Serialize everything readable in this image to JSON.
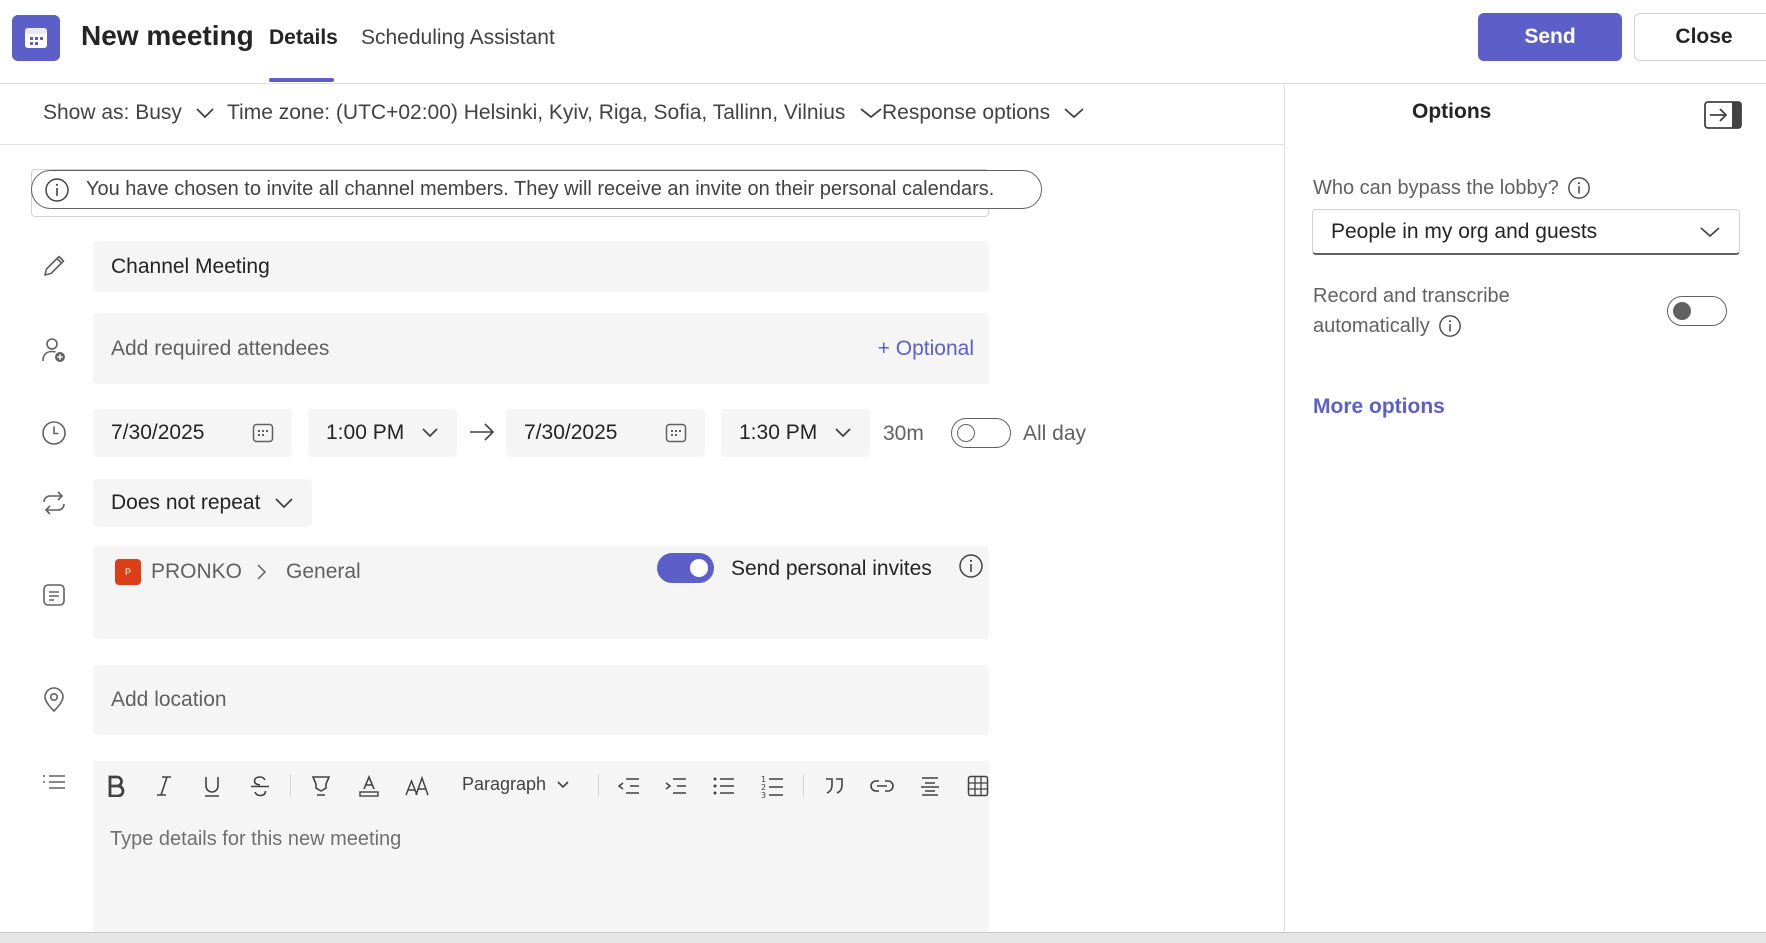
{
  "header": {
    "title": "New meeting",
    "tabs": [
      {
        "label": "Details",
        "active": true
      },
      {
        "label": "Scheduling Assistant",
        "active": false
      }
    ],
    "send_label": "Send",
    "close_label": "Close"
  },
  "subbar": {
    "show_as": "Show as: Busy",
    "time_zone": "Time zone: (UTC+02:00) Helsinki, Kyiv, Riga, Sofia, Tallinn, Vilnius",
    "response_options": "Response options"
  },
  "banner": {
    "text": "You have chosen to invite all channel members. They will receive an invite on their personal calendars."
  },
  "form": {
    "title_value": "Channel Meeting",
    "attendees_placeholder": "Add required attendees",
    "optional_link": "+ Optional",
    "start_date": "7/30/2025",
    "start_time": "1:00 PM",
    "end_date": "7/30/2025",
    "end_time": "1:30 PM",
    "duration": "30m",
    "all_day_label": "All day",
    "all_day_on": false,
    "repeat": "Does not repeat",
    "channel": {
      "team_badge": "P",
      "team": "PRONKO",
      "channel": "General",
      "send_invites_label": "Send personal invites",
      "send_invites_on": true
    },
    "location_placeholder": "Add location",
    "editor": {
      "paragraph_label": "Paragraph",
      "placeholder": "Type details for this new meeting"
    }
  },
  "options_panel": {
    "title": "Options",
    "lobby_label": "Who can bypass the lobby?",
    "lobby_value": "People in my org and guests",
    "record_label_line1": "Record and transcribe",
    "record_label_line2": "automatically",
    "record_on": false,
    "more_options": "More options"
  },
  "colors": {
    "accent": "#5b5fc7",
    "field_bg": "#f5f5f5",
    "team_badge": "#dc3e15"
  },
  "icons": {
    "app": "calendar-icon",
    "title": "pencil-icon",
    "attendees": "person-add-icon",
    "time": "clock-icon",
    "repeat": "repeat-icon",
    "channel": "channel-icon",
    "location": "location-icon",
    "details": "text-list-icon"
  }
}
